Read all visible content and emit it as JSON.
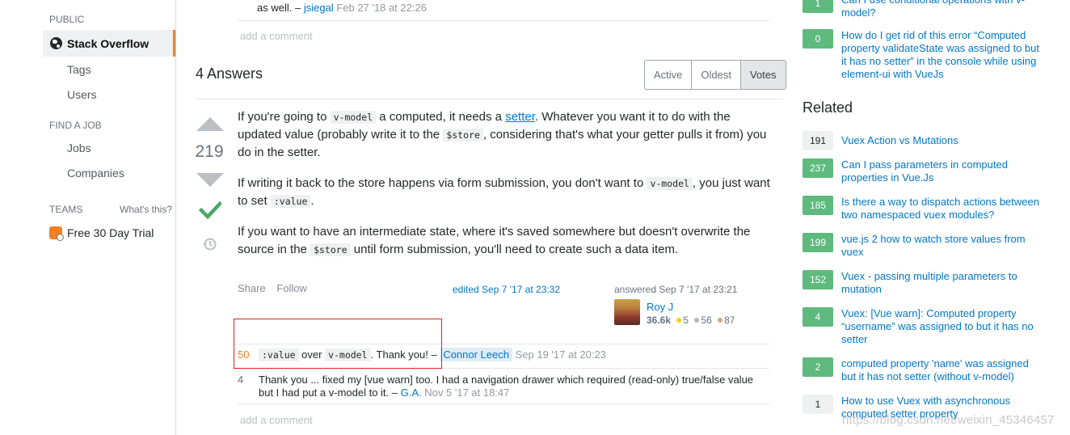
{
  "left_nav": {
    "public_label": "PUBLIC",
    "active_item": "Stack Overflow",
    "tags": "Tags",
    "users": "Users",
    "find_job_label": "FIND A JOB",
    "jobs": "Jobs",
    "companies": "Companies",
    "teams_label": "TEAMS",
    "whats_this": "What's this?",
    "free_trial": "Free 30 Day Trial"
  },
  "top_comment": {
    "text": "as well. –",
    "user": "jsiegal",
    "time": "Feb 27 '18 at 22:26"
  },
  "add_comment_label": "add a comment",
  "answers": {
    "heading": "4 Answers",
    "tabs": [
      "Active",
      "Oldest",
      "Votes"
    ],
    "active_tab": "Votes"
  },
  "answer": {
    "votes": "219",
    "p1_a": "If you're going to ",
    "p1_code1": "v-model",
    "p1_b": " a computed, it needs a ",
    "p1_link": "setter",
    "p1_c": ". Whatever you want it to do with the updated value (probably write it to the ",
    "p1_code2": "$store",
    "p1_d": ", considering that's what your getter pulls it from) you do in the setter.",
    "p2_a": "If writing it back to the store happens via form submission, you don't want to ",
    "p2_code1": "v-model",
    "p2_b": ", you just want to set ",
    "p2_code2": ":value",
    "p2_c": ".",
    "p3_a": "If you want to have an intermediate state, where it's saved somewhere but doesn't overwrite the source in the ",
    "p3_code1": "$store",
    "p3_b": " until form submission, you'll need to create such a data item.",
    "share": "Share",
    "follow": "Follow",
    "edited": "edited Sep 7 '17 at 23:32",
    "answered": "answered Sep 7 '17 at 23:21",
    "user_name": "Roy J",
    "reputation": "36.6k",
    "gold": "5",
    "silver": "56",
    "bronze": "87"
  },
  "comments": [
    {
      "score": "50",
      "code1": ":value",
      "mid": " over ",
      "code2": "v-model",
      "text": ". Thank you! –",
      "user": "Connor Leech",
      "time": "Sep 19 '17 at 20:23"
    },
    {
      "score": "4",
      "text": "Thank you ... fixed my [vue warn] too. I had a navigation drawer which required (read-only) true/false value but I had put a v-model to it. –",
      "user": "G.A.",
      "time": "Nov 5 '17 at 18:47"
    }
  ],
  "linked": [
    {
      "score": "1",
      "title": "Can I use conditional operations with v-model?"
    },
    {
      "score": "0",
      "title": "How do I get rid of this error “Computed property validateState was assigned to but it has no setter” in the console while using element-ui with VueJs"
    }
  ],
  "related": {
    "heading": "Related",
    "items": [
      {
        "score": "191",
        "title": "Vuex Action vs Mutations"
      },
      {
        "score": "237",
        "title": "Can I pass parameters in computed properties in Vue.Js"
      },
      {
        "score": "185",
        "title": "Is there a way to dispatch actions between two namespaced vuex modules?"
      },
      {
        "score": "199",
        "title": "vue.js 2 how to watch store values from vuex"
      },
      {
        "score": "152",
        "title": "Vuex - passing multiple parameters to mutation"
      },
      {
        "score": "4",
        "title": "Vuex: [Vue warn]: Computed property “username” was assigned to but it has no setter"
      },
      {
        "score": "2",
        "title": "computed property 'name' was assigned but it has not setter (without v-model)"
      },
      {
        "score": "1",
        "title": "How to use Vuex with asynchronous computed setter property"
      }
    ]
  },
  "watermark": "https://blog.csdn.net/weixin_45346457",
  "colors": {
    "accent": "#f48024",
    "link": "#0077cc",
    "answered_badge": "#5eba7d",
    "highlight_box": "#e02020"
  }
}
